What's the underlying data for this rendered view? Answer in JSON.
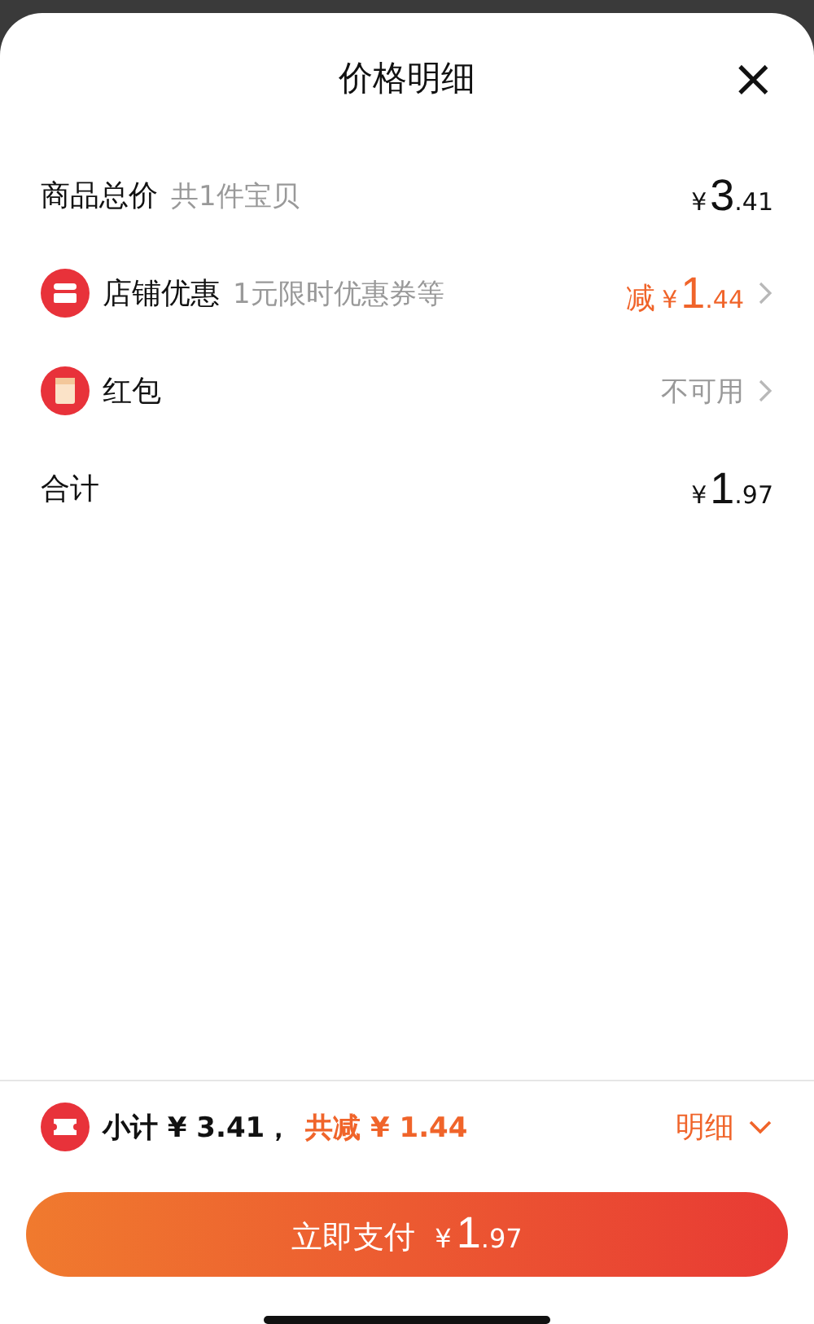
{
  "sheet": {
    "title": "价格明细",
    "close": "×"
  },
  "rows": [
    {
      "kind": "plain",
      "label": "商品总价",
      "note": "共1件宝贝",
      "price": {
        "currency": "¥",
        "integer": "3",
        "decimal": ".41"
      }
    },
    {
      "kind": "shop",
      "label": "店铺优惠",
      "note": "1元限时优惠券等",
      "price": {
        "prefix": "减",
        "currency": "¥",
        "integer": "1",
        "decimal": ".44"
      }
    },
    {
      "kind": "packet",
      "label": "红包",
      "status": "不可用"
    },
    {
      "kind": "plain",
      "label": "合计",
      "price": {
        "currency": "¥",
        "integer": "1",
        "decimal": ".97"
      }
    }
  ],
  "summary": {
    "subtotal": "小计 ¥ 3.41，",
    "discount": "共减 ¥ 1.44",
    "details": "明细",
    "expanded": false
  },
  "pay_button": {
    "label": "立即支付",
    "currency": "¥",
    "integer": "1",
    "decimal": ".97"
  }
}
